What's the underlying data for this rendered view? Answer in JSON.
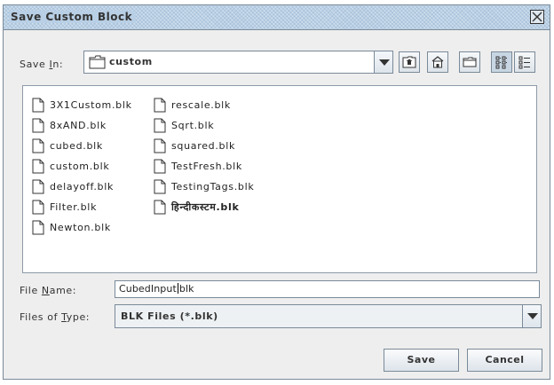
{
  "dialog": {
    "title": "Save Custom Block"
  },
  "save_in": {
    "label_pre": "Save ",
    "label_mnemonic": "I",
    "label_post": "n:",
    "folder": "custom"
  },
  "toolbar_icons": [
    "up-folder-icon",
    "home-icon",
    "new-folder-icon",
    "list-view-icon",
    "details-view-icon"
  ],
  "files": [
    {
      "name": "3X1Custom.blk"
    },
    {
      "name": "8xAND.blk"
    },
    {
      "name": "cubed.blk"
    },
    {
      "name": "custom.blk"
    },
    {
      "name": "delayoff.blk"
    },
    {
      "name": "Filter.blk"
    },
    {
      "name": "Newton.blk"
    },
    {
      "name": "rescale.blk"
    },
    {
      "name": "Sqrt.blk"
    },
    {
      "name": "squared.blk"
    },
    {
      "name": "TestFresh.blk"
    },
    {
      "name": "TestingTags.blk"
    },
    {
      "name": "हिन्दीकस्टम.blk"
    }
  ],
  "file_name": {
    "label_pre": "File ",
    "label_mnemonic": "N",
    "label_post": "ame:",
    "value_before_caret": "CubedInput",
    "value_after_caret": "blk"
  },
  "file_type": {
    "label_pre": "Files of ",
    "label_mnemonic": "T",
    "label_post": "ype:",
    "value": "BLK Files (*.blk)"
  },
  "buttons": {
    "save": "Save",
    "cancel": "Cancel"
  },
  "colors": {
    "titlebar": "#b8cfe5",
    "dialog_bg": "#eeeeee",
    "border": "#7a8a99"
  }
}
